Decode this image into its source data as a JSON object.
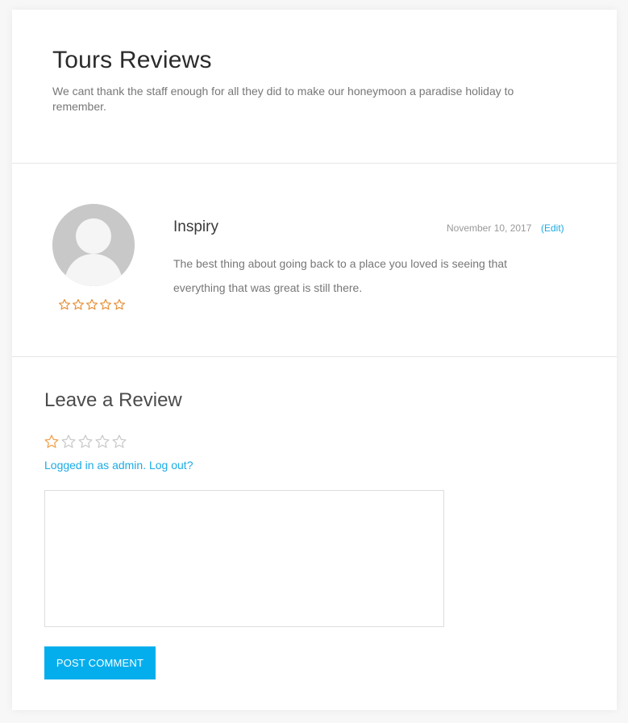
{
  "header": {
    "title": "Tours Reviews",
    "subtitle": "We cant thank the staff enough for all they did to make our honeymoon a paradise holiday to remember."
  },
  "review": {
    "author": "Inspiry",
    "date": "November 10, 2017",
    "edit_label": "(Edit)",
    "text": "The best thing about going back to a place you loved is seeing that everything that was great is still there.",
    "rating": 0,
    "rating_max": 5,
    "star_color": "#e8913a"
  },
  "leave_review": {
    "title": "Leave a Review",
    "rating": 1,
    "rating_max": 5,
    "logged_in_text": "Logged in as admin.",
    "logout_label": "Log out?",
    "comment_value": "",
    "submit_label": "POST COMMENT",
    "accent_color": "#04aeed",
    "active_star_color": "#f0a04b",
    "inactive_star_color": "#c9c9c9"
  }
}
